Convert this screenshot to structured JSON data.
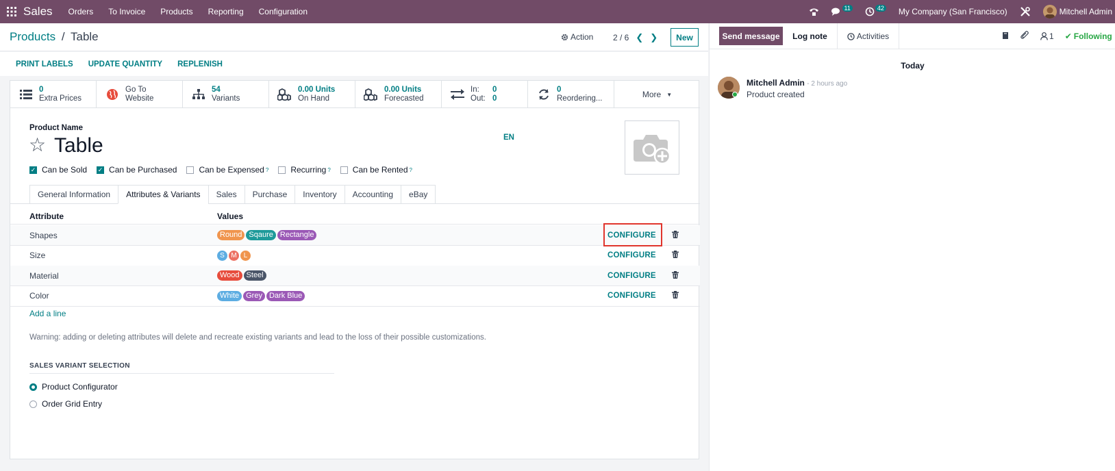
{
  "navbar": {
    "brand": "Sales",
    "menu": [
      "Orders",
      "To Invoice",
      "Products",
      "Reporting",
      "Configuration"
    ],
    "messages_count": "11",
    "activities_count": "42",
    "company": "My Company (San Francisco)",
    "user": "Mitchell Admin"
  },
  "control_panel": {
    "breadcrumb_parent": "Products",
    "breadcrumb_sep": "/",
    "breadcrumb_current": "Table",
    "action_label": "Action",
    "pager": "2 / 6",
    "new_label": "New"
  },
  "statusbar": {
    "buttons": [
      "PRINT LABELS",
      "UPDATE QUANTITY",
      "REPLENISH"
    ]
  },
  "smart_buttons": [
    {
      "value": "0",
      "label": "Extra Prices",
      "icon": "list-icon"
    },
    {
      "value": "Go To",
      "label": "Website",
      "icon": "globe-icon"
    },
    {
      "value": "54",
      "label": "Variants",
      "icon": "sitemap-icon"
    },
    {
      "value": "0.00 Units",
      "label": "On Hand",
      "icon": "cubes-icon"
    },
    {
      "value": "0.00 Units",
      "label": "Forecasted",
      "icon": "cubes-icon"
    },
    {
      "in_label": "In:",
      "in_value": "0",
      "out_label": "Out:",
      "out_value": "0",
      "icon": "exchange-icon"
    },
    {
      "value": "0",
      "label": "Reordering...",
      "icon": "refresh-icon"
    },
    {
      "label": "More"
    }
  ],
  "form": {
    "product_name_label": "Product Name",
    "product_name": "Table",
    "lang": "EN",
    "checkboxes": [
      {
        "label": "Can be Sold",
        "checked": true,
        "help": ""
      },
      {
        "label": "Can be Purchased",
        "checked": true,
        "help": ""
      },
      {
        "label": "Can be Expensed",
        "checked": false,
        "help": "?"
      },
      {
        "label": "Recurring",
        "checked": false,
        "help": "?"
      },
      {
        "label": "Can be Rented",
        "checked": false,
        "help": "?"
      }
    ],
    "tabs": [
      "General Information",
      "Attributes & Variants",
      "Sales",
      "Purchase",
      "Inventory",
      "Accounting",
      "eBay"
    ],
    "active_tab": "Attributes & Variants"
  },
  "attributes": {
    "col_attribute": "Attribute",
    "col_values": "Values",
    "configure_label": "CONFIGURE",
    "rows": [
      {
        "name": "Shapes",
        "values": [
          {
            "t": "Round",
            "c": "#f0954e"
          },
          {
            "t": "Sqaure",
            "c": "#1e9a9a"
          },
          {
            "t": "Rectangle",
            "c": "#9b59b6"
          }
        ]
      },
      {
        "name": "Size",
        "values": [
          {
            "t": "S",
            "c": "#5dade2"
          },
          {
            "t": "M",
            "c": "#ec7063"
          },
          {
            "t": "L",
            "c": "#f0954e"
          }
        ]
      },
      {
        "name": "Material",
        "values": [
          {
            "t": "Wood",
            "c": "#e74c3c"
          },
          {
            "t": "Steel",
            "c": "#4a5568"
          }
        ]
      },
      {
        "name": "Color",
        "values": [
          {
            "t": "White",
            "c": "#5dade2"
          },
          {
            "t": "Grey",
            "c": "#9b59b6"
          },
          {
            "t": "Dark Blue",
            "c": "#9b59b6"
          }
        ]
      }
    ],
    "add_line": "Add a line",
    "warning": "Warning: adding or deleting attributes will delete and recreate existing variants and lead to the loss of their possible customizations."
  },
  "variant_selection": {
    "title": "SALES VARIANT SELECTION",
    "options": [
      {
        "label": "Product Configurator",
        "selected": true
      },
      {
        "label": "Order Grid Entry",
        "selected": false
      }
    ]
  },
  "chatter": {
    "send_message": "Send message",
    "log_note": "Log note",
    "activities": "Activities",
    "followers_count": "1",
    "following": "Following",
    "today": "Today",
    "message": {
      "author": "Mitchell Admin",
      "time": "- 2 hours ago",
      "body": "Product created"
    }
  }
}
